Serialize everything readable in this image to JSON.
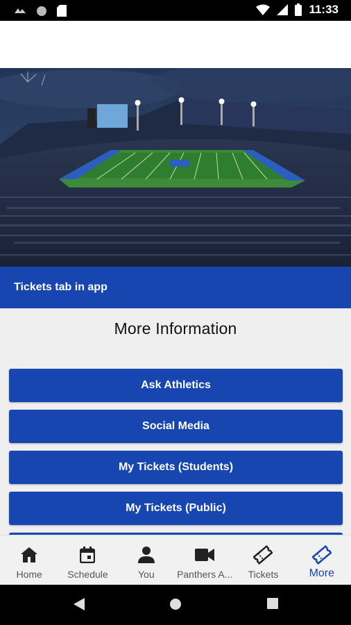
{
  "status_bar": {
    "time": "11:33"
  },
  "banner": {
    "text": "Tickets tab in app"
  },
  "content": {
    "title": "More Information",
    "buttons": [
      {
        "label": "Ask Athletics"
      },
      {
        "label": "Social Media"
      },
      {
        "label": "My Tickets (Students)"
      },
      {
        "label": "My Tickets (Public)"
      }
    ]
  },
  "bottom_nav": {
    "items": [
      {
        "label": "Home",
        "icon": "home-icon"
      },
      {
        "label": "Schedule",
        "icon": "calendar-icon"
      },
      {
        "label": "You",
        "icon": "person-icon"
      },
      {
        "label": "Panthers A...",
        "icon": "video-camera-icon"
      },
      {
        "label": "Tickets",
        "icon": "ticket-icon"
      },
      {
        "label": "More",
        "icon": "ticket-icon",
        "active": true
      }
    ]
  },
  "colors": {
    "brand_blue": "#1746b0",
    "nav_inactive": "#555555"
  }
}
